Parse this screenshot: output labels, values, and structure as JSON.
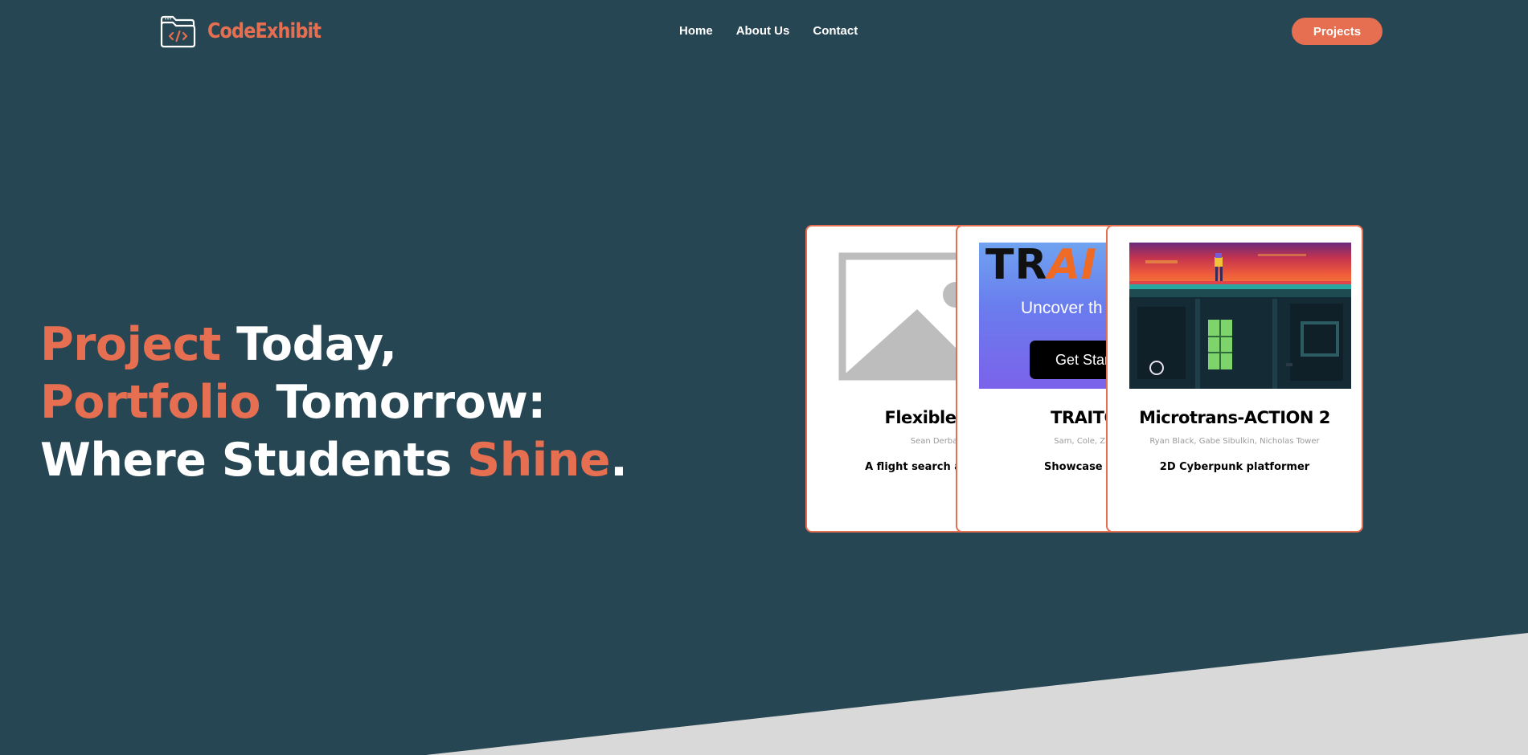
{
  "header": {
    "logo_text": "CodeExhibit",
    "logo_icon": "folder-code-icon",
    "nav": [
      {
        "label": "Home"
      },
      {
        "label": "About Us"
      },
      {
        "label": "Contact"
      }
    ],
    "cta_label": "Projects"
  },
  "hero": {
    "line1_accent": "Project",
    "line1_rest": " Today,",
    "line2_accent": "Portfolio",
    "line2_rest": " Tomorrow:",
    "line3_start": "Where Students ",
    "line3_accent": "Shine",
    "line3_end": "."
  },
  "projects": [
    {
      "title": "Flexible Fli",
      "authors": "Sean Derba",
      "description": "A flight search and mar",
      "image": "placeholder-image-icon"
    },
    {
      "title": "TRAITO",
      "authors": "Sam, Cole, Zac",
      "description": "Showcase Wo",
      "image": "traitor-screenshot",
      "image_text": {
        "logo_start": "TR",
        "logo_accent": "AI",
        "subtitle": "Uncover th",
        "button": "Get Star"
      }
    },
    {
      "title": "Microtrans-ACTION 2",
      "authors": "Ryan Black, Gabe Sibulkin, Nicholas Tower",
      "description": "2D Cyberpunk platformer",
      "image": "cyberpunk-game-screenshot"
    }
  ],
  "colors": {
    "background": "#264653",
    "accent": "#e76f51",
    "text": "#ffffff",
    "bottom_band": "#d9d9d9"
  }
}
